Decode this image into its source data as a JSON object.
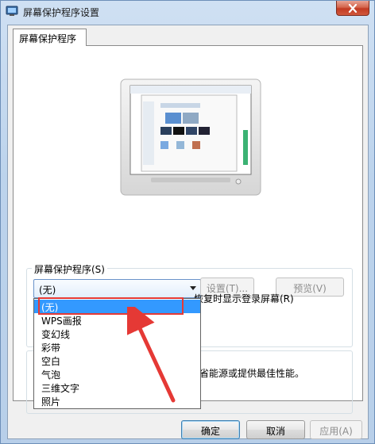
{
  "window": {
    "title": "屏幕保护程序设置"
  },
  "tabs": [
    {
      "label": "屏幕保护程序"
    }
  ],
  "screensaver": {
    "group_label": "屏幕保护程序(S)",
    "selected": "(无)",
    "settings_button": "设置(T)...",
    "preview_button": "预览(V)",
    "resume_text": "恢复时显示登录屏幕(R)",
    "options": [
      "(无)",
      "WPS画报",
      "变幻线",
      "彩带",
      "空白",
      "气泡",
      "三维文字",
      "照片"
    ]
  },
  "power": {
    "text": "省能源或提供最佳性能。"
  },
  "footer": {
    "ok": "确定",
    "cancel": "取消",
    "apply": "应用(A)"
  },
  "colors": {
    "selection": "#3399ff",
    "annotation": "#e53935"
  },
  "icons": {
    "close": "close-icon",
    "app": "screensaver-settings-icon"
  }
}
